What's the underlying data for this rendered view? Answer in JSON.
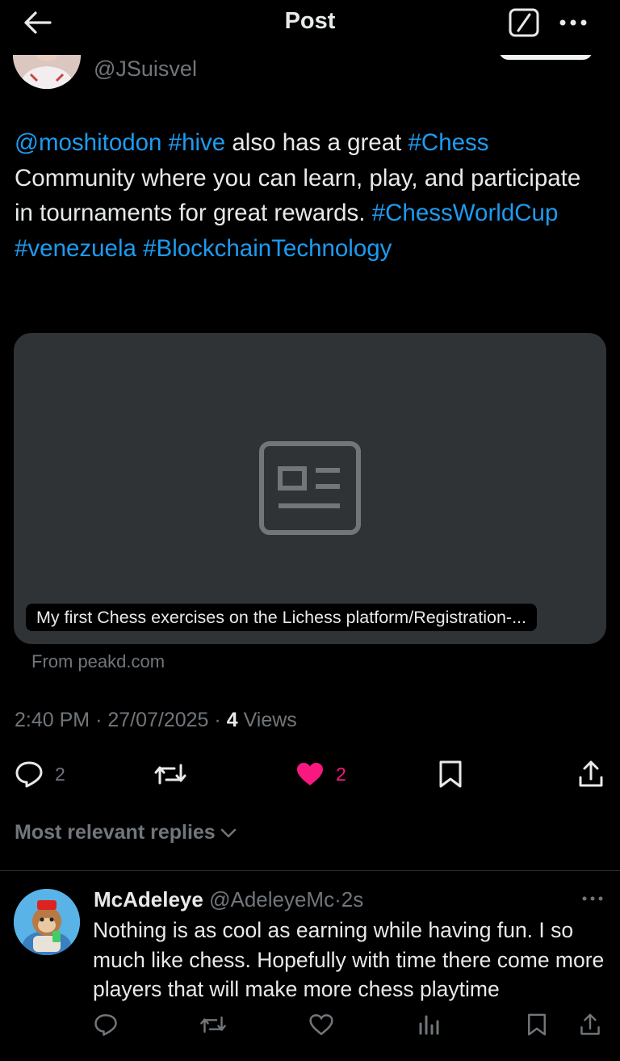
{
  "header": {
    "title": "Post",
    "back_icon": "arrow-left-icon",
    "grok_icon": "grok-icon",
    "more_icon": "more-icon"
  },
  "author": {
    "handle": "@JSuisvel"
  },
  "post": {
    "text_parts": [
      {
        "text": "@moshitodon",
        "link": true
      },
      {
        "text": " ",
        "link": false
      },
      {
        "text": "#hive",
        "link": true
      },
      {
        "text": " also has a great ",
        "link": false
      },
      {
        "text": "#Chess",
        "link": true
      },
      {
        "text": " Community where you can learn, play, and participate in tournaments for great rewards. ",
        "link": false
      },
      {
        "text": "#ChessWorldCup",
        "link": true
      },
      {
        "text": " ",
        "link": false
      },
      {
        "text": "#venezuela",
        "link": true
      },
      {
        "text": " ",
        "link": false
      },
      {
        "text": "#BlockchainTechnology",
        "link": true
      }
    ],
    "link_color": "#1d9bf0"
  },
  "card": {
    "caption": "My first Chess exercises on the Lichess platform/Registration-...",
    "source": "From peakd.com",
    "icon": "article-icon"
  },
  "meta": {
    "time": "2:40 PM",
    "date": "27/07/2025",
    "views_count": "4",
    "views_label": "Views"
  },
  "actions": {
    "replies": "2",
    "reposts": "",
    "likes": "2",
    "like_color": "#f91880"
  },
  "replies_section": {
    "sort_label": "Most relevant replies"
  },
  "reply": {
    "name": "McAdeleye",
    "handle": "@AdeleyeMc",
    "separator": "·",
    "time": "2s",
    "text": "Nothing is as cool as earning while having fun. I so much like chess. Hopefully with time there come more players that will make more chess playtime"
  }
}
